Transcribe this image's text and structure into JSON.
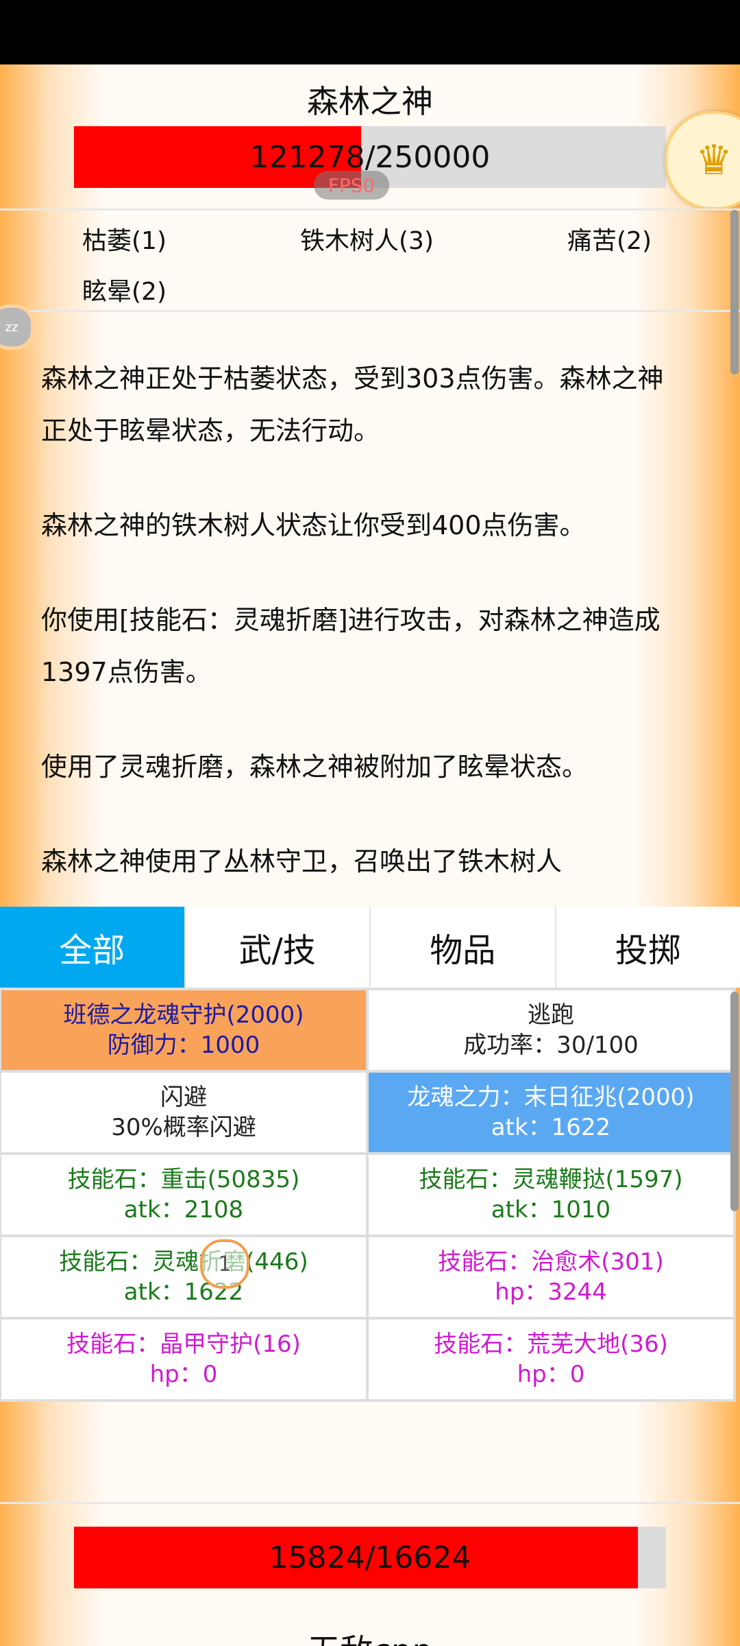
{
  "boss": {
    "name": "森林之神",
    "hp_text": "121278/250000",
    "hp_fraction": 0.485
  },
  "fps_label": "FPS0",
  "statuses": [
    "枯萎(1)",
    "铁木树人(3)",
    "痛苦(2)",
    "眩晕(2)"
  ],
  "log": [
    "森林之神正处于枯萎状态，受到303点伤害。森林之神正处于眩晕状态，无法行动。",
    "森林之神的铁木树人状态让你受到400点伤害。",
    "你使用[技能石：灵魂折磨]进行攻击，对森林之神造成1397点伤害。",
    "使用了灵魂折磨，森林之神被附加了眩晕状态。",
    "森林之神使用了丛林守卫，召唤出了铁木树人"
  ],
  "tabs": [
    "全部",
    "武/技",
    "物品",
    "投掷"
  ],
  "skills": [
    {
      "line1": "班德之龙魂守护(2000)",
      "line2": "防御力：1000"
    },
    {
      "line1": "逃跑",
      "line2": "成功率：30/100"
    },
    {
      "line1": "闪避",
      "line2": "30%概率闪避"
    },
    {
      "line1": "龙魂之力：末日征兆(2000)",
      "line2": "atk：1622"
    },
    {
      "line1": "技能石：重击(50835)",
      "line2": "atk：2108"
    },
    {
      "line1": "技能石：灵魂鞭挞(1597)",
      "line2": "atk：1010"
    },
    {
      "line1": "技能石：灵魂折磨(446)",
      "line2": "atk：1622"
    },
    {
      "line1": "技能石：治愈术(301)",
      "line2": "hp：3244"
    },
    {
      "line1": "技能石：晶甲守护(16)",
      "line2": "hp：0"
    },
    {
      "line1": "技能石：荒芜大地(36)",
      "line2": "hp：0"
    }
  ],
  "cursor_label": "1",
  "player": {
    "name": "无敌cpp",
    "hp_text": "15824/16624",
    "hp_fraction": 0.952
  },
  "colors": {
    "hp": "#ff0000",
    "active_tab": "#00a8f0",
    "skill_orange": "#f9a25a",
    "skill_blue": "#5aa8f2",
    "green_text": "#1a7a1a",
    "magenta_text": "#d01ad0"
  }
}
